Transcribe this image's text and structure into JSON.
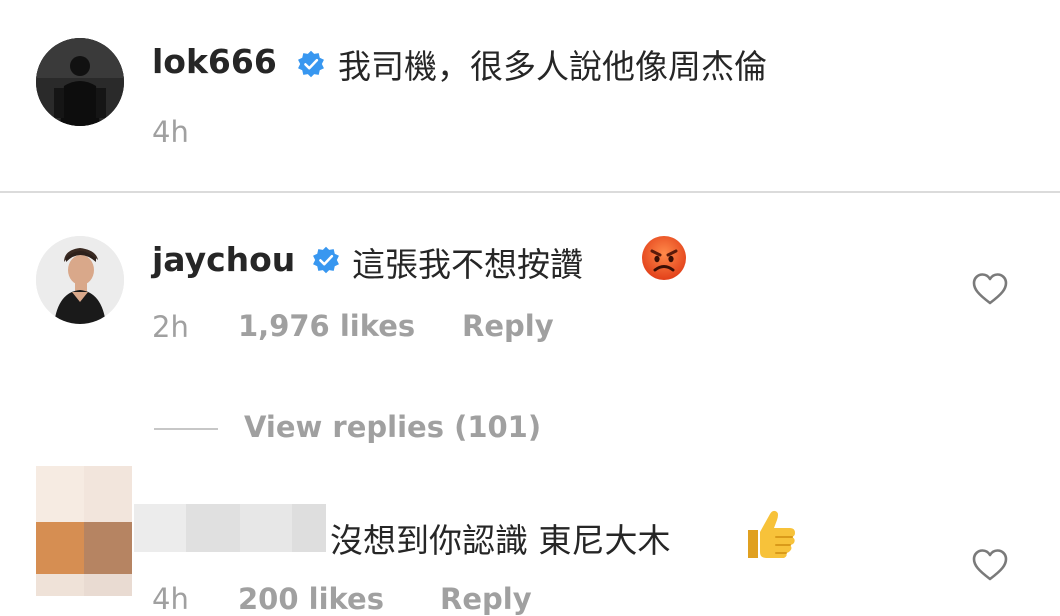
{
  "comments": [
    {
      "username": "lok666",
      "text": "我司機，很多人說他像周杰倫",
      "time": "4h"
    },
    {
      "username": "jaychou",
      "text": "這張我不想按讚",
      "time": "2h",
      "likes": "1,976 likes",
      "reply_label": "Reply",
      "view_replies": "View replies (101)"
    },
    {
      "username": "",
      "text": "沒想到你認識 東尼大木",
      "time": "4h",
      "likes": "200 likes",
      "reply_label": "Reply"
    }
  ],
  "icons": {
    "verified": "verified-badge-icon",
    "heart": "heart-outline-icon",
    "angry": "angry-face-emoji",
    "thumbs_up": "thumbs-up-emoji"
  },
  "colors": {
    "verified_blue": "#3897f0",
    "meta_gray": "#a0a0a0",
    "divider": "#dbdbdb"
  }
}
